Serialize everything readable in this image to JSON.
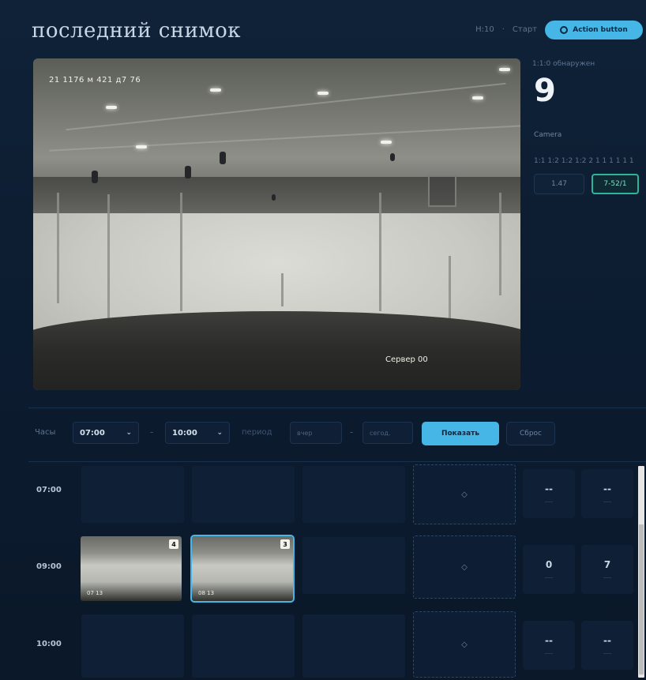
{
  "header": {
    "title": "последний снимок",
    "meta_time": "H:10",
    "meta_dot": "·",
    "meta_label": "Старт",
    "action_label": "Action button"
  },
  "camera": {
    "timestamp": "21 1176 м 421 д7 76",
    "label": "Сервер 00"
  },
  "stats": {
    "label": "1:1:0 обнаружен",
    "value": "9",
    "sub": "Camera",
    "sub2": "1:1 1:2 1:2 1:2 2 1 1 1 1 1 1",
    "chip_a": "1.47",
    "chip_b": "7-52/1"
  },
  "filters": {
    "label": "Часы",
    "from_value": "07:00",
    "to_value": "10:00",
    "date_label": "период",
    "date_from_placeholder": "вчер",
    "date_to_placeholder": "сегод.",
    "apply_label": "Показать",
    "reset_label": "Сброс",
    "chevron": "⌄",
    "dash": "-"
  },
  "grid": {
    "rows": [
      {
        "time": "07:00",
        "stats": [
          {
            "value": "--",
            "label": "-----"
          },
          {
            "value": "--",
            "label": "-----"
          }
        ]
      },
      {
        "time": "09:00",
        "thumbs": [
          {
            "badge": "4",
            "time": "07 13"
          },
          {
            "badge": "3",
            "time": "08 13"
          }
        ],
        "stats": [
          {
            "value": "0",
            "label": "-----"
          },
          {
            "value": "7",
            "label": "-----"
          }
        ]
      },
      {
        "time": "10:00",
        "stats": [
          {
            "value": "--",
            "label": "-----"
          },
          {
            "value": "--",
            "label": "-----"
          }
        ]
      }
    ],
    "empty_symbol": "◇"
  },
  "colors": {
    "accent": "#45b6e6",
    "success": "#2fb39a",
    "background": "#0b1a2e"
  }
}
